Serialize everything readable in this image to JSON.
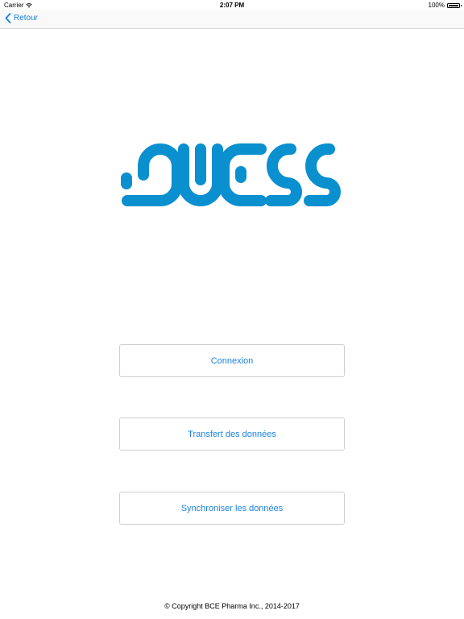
{
  "status_bar": {
    "carrier": "Carrier",
    "time": "2:07 PM",
    "battery": "100%",
    "battery_level": 1.0
  },
  "nav_bar": {
    "back_label": "Retour"
  },
  "brand": {
    "logo_text": "QUESS",
    "color": "#0a8fcf"
  },
  "menu": {
    "buttons": [
      {
        "label": "Connexion"
      },
      {
        "label": "Transfert des données"
      },
      {
        "label": "Synchroniser les données"
      }
    ]
  },
  "footer": {
    "copyright": "© Copyright BCE Pharma Inc., 2014-2017"
  },
  "colors": {
    "accent": "#1a82e2",
    "logo": "#0a8fcf",
    "border": "#cfcfcf"
  }
}
